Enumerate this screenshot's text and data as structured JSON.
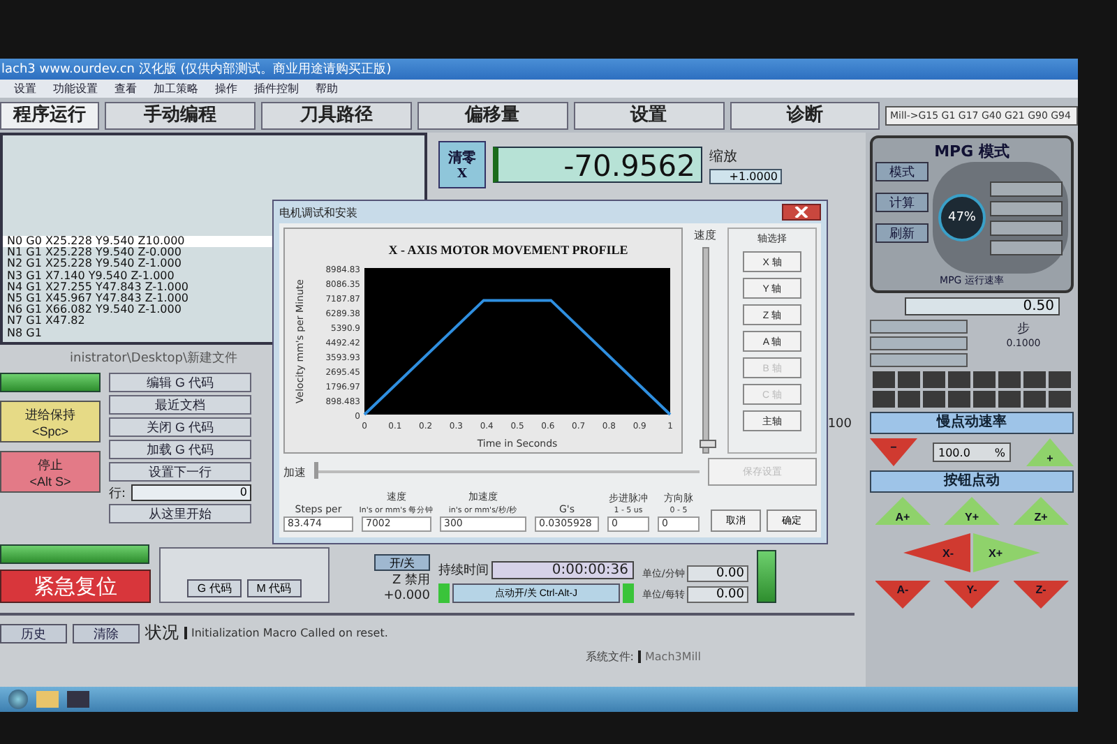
{
  "window": {
    "title": "lach3 www.ourdev.cn 汉化版 (仅供内部测试。商业用途请购买正版)"
  },
  "menu": [
    "设置",
    "功能设置",
    "查看",
    "加工策略",
    "操作",
    "插件控制",
    "帮助"
  ],
  "tabs": [
    {
      "label": "程序运行",
      "selected": true
    },
    {
      "label": "手动编程",
      "selected": false
    },
    {
      "label": "刀具路径",
      "selected": false
    },
    {
      "label": "偏移量",
      "selected": false
    },
    {
      "label": "设置",
      "selected": false
    },
    {
      "label": "诊断",
      "selected": false
    }
  ],
  "modal_codes": "Mill->G15  G1 G17 G40 G21 G90 G94",
  "gcode_lines": [
    {
      "text": "N0 G0 X25.228 Y9.540 Z10.000",
      "selected": true
    },
    {
      "text": "N1 G1 X25.228 Y9.540 Z-0.000",
      "selected": false
    },
    {
      "text": "N2 G1 X25.228 Y9.540 Z-1.000",
      "selected": false
    },
    {
      "text": "N3 G1 X7.140 Y9.540 Z-1.000",
      "selected": false
    },
    {
      "text": "N4 G1 X27.255 Y47.843 Z-1.000",
      "selected": false
    },
    {
      "text": "N5 G1 X45.967 Y47.843 Z-1.000",
      "selected": false
    },
    {
      "text": "N6 G1 X66.082 Y9.540 Z-1.000",
      "selected": false
    },
    {
      "text": "N7 G1 X47.82",
      "selected": false
    },
    {
      "text": "N8 G1",
      "selected": false
    }
  ],
  "file_path": "inistrator\\Desktop\\新建文件",
  "dro": [
    {
      "button": "清零",
      "axis": "X",
      "value": "-70.9562",
      "scale_label": "缩放",
      "scale": "+1.0000"
    }
  ],
  "control_buttons": [
    {
      "label": "进给保持",
      "key": "<Spc>",
      "kind": "hold"
    },
    {
      "label": "停止",
      "key": "<Alt S>",
      "kind": "stop"
    }
  ],
  "reset_button": "紧急复位",
  "file_buttons": [
    "编辑 G 代码",
    "最近文档",
    "关闭 G 代码",
    "加载 G 代码",
    "设置下一行"
  ],
  "line_field": {
    "label": "行:",
    "value": "0"
  },
  "run_from_here": "从这里开始",
  "code_buttons": [
    "G 代码",
    "M 代码"
  ],
  "z_inhibit": {
    "button": "开/关",
    "label": "Z 禁用",
    "value": "+0.000"
  },
  "elapsed": {
    "label": "持续时间",
    "value": "0:00:00:36"
  },
  "jog_toggle": "点动开/关 Ctrl-Alt-J",
  "feed": [
    {
      "label": "单位/分钟",
      "value": "0.00"
    },
    {
      "label": "单位/每转",
      "value": "0.00"
    }
  ],
  "feedrate_partial": "100",
  "status_bar": {
    "history": "历史",
    "clear": "清除",
    "label": "状况",
    "message": "Initialization Macro Called on reset.",
    "profile_label": "系统文件:",
    "profile": "Mach3Mill"
  },
  "mpg": {
    "title": "MPG 模式",
    "buttons": [
      "模式",
      "计算",
      "刷新"
    ],
    "gauge": "47%",
    "rate_label": "MPG 运行速率",
    "rate": "0.50",
    "step_label": "步",
    "step": "0.1000",
    "slow_jog_label": "慢点动速率",
    "slow_jog_value": "100.0",
    "percent": "%",
    "minus": "−",
    "plus": "+",
    "button_jog_label": "按钮点动",
    "jog_buttons": [
      {
        "label": "A+",
        "kind": "up"
      },
      {
        "label": "Y+",
        "kind": "up"
      },
      {
        "label": "Z+",
        "kind": "up"
      },
      {
        "label": "X-",
        "kind": "left"
      },
      {
        "label": "X+",
        "kind": "right"
      },
      {
        "label": "A-",
        "kind": "down"
      },
      {
        "label": "Y-",
        "kind": "down"
      },
      {
        "label": "Z-",
        "kind": "down"
      }
    ]
  },
  "dialog": {
    "title": "电机调试和安装",
    "chart_data": {
      "type": "line",
      "title": "X - AXIS MOTOR MOVEMENT PROFILE",
      "xlabel": "Time in Seconds",
      "ylabel": "Velocity mm's per Minute",
      "x": [
        0,
        0.39,
        0.61,
        1
      ],
      "series": [
        {
          "color": "#2f8fe0",
          "values": [
            0,
            7000,
            7000,
            0
          ]
        }
      ],
      "xlim": [
        0,
        1
      ],
      "ylim": [
        0,
        8984.83
      ],
      "xticks": [
        0,
        0.1,
        0.2,
        0.3,
        0.4,
        0.5,
        0.6,
        0.7,
        0.8,
        0.9,
        1
      ],
      "yticks": [
        0,
        898.483,
        1796.97,
        2695.45,
        3593.93,
        4492.42,
        5390.9,
        6289.38,
        7187.87,
        8086.35,
        8984.83
      ]
    },
    "speed_label": "速度",
    "speed_slider": {
      "level": 0.02
    },
    "axis_group_label": "轴选择",
    "axis_buttons": [
      {
        "label": "X 轴",
        "disabled": false
      },
      {
        "label": "Y 轴",
        "disabled": false
      },
      {
        "label": "Z 轴",
        "disabled": false
      },
      {
        "label": "A 轴",
        "disabled": false
      },
      {
        "label": "B 轴",
        "disabled": true
      },
      {
        "label": "C 轴",
        "disabled": true
      },
      {
        "label": "主轴",
        "disabled": false
      }
    ],
    "save_button": {
      "label": "保存设置",
      "disabled": true
    },
    "accel_label": "加速",
    "accel_slider": {
      "level": 0.0
    },
    "fields": [
      {
        "label": "Steps per",
        "value": "83.474"
      },
      {
        "label": "速度",
        "sublabel": "In's or mm's 每分钟",
        "value": "7002"
      },
      {
        "label": "加速度",
        "sublabel": "in's or mm's/秒/秒",
        "value": "300"
      },
      {
        "label": "G's",
        "value": "0.0305928"
      },
      {
        "label": "步进脉冲",
        "sublabel": "1 - 5 us",
        "value": "0"
      },
      {
        "label": "方向脉",
        "sublabel": "0 - 5",
        "value": "0"
      }
    ],
    "buttons": [
      "取消",
      "确定"
    ]
  }
}
